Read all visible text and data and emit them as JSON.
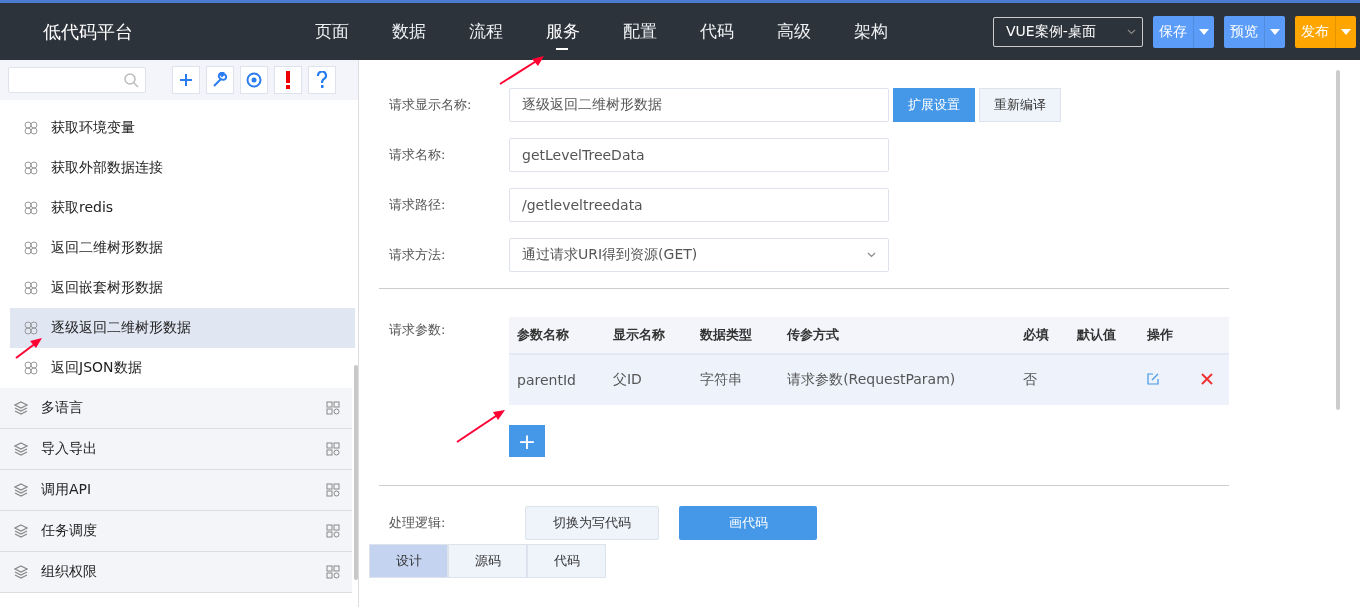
{
  "header": {
    "title": "低代码平台",
    "nav": [
      {
        "label": "页面",
        "selected": false
      },
      {
        "label": "数据",
        "selected": false
      },
      {
        "label": "流程",
        "selected": false
      },
      {
        "label": "服务",
        "selected": true
      },
      {
        "label": "配置",
        "selected": false
      },
      {
        "label": "代码",
        "selected": false
      },
      {
        "label": "高级",
        "selected": false
      },
      {
        "label": "架构",
        "selected": false
      }
    ],
    "project_select": "VUE案例-桌面",
    "buttons": [
      {
        "label": "保存",
        "kind": "blue"
      },
      {
        "label": "预览",
        "kind": "blue"
      },
      {
        "label": "发布",
        "kind": "orange"
      }
    ]
  },
  "sidebar": {
    "tools": [
      {
        "kind": "plus"
      },
      {
        "kind": "wrench"
      },
      {
        "kind": "target"
      },
      {
        "kind": "alert"
      },
      {
        "kind": "help"
      }
    ],
    "items": [
      {
        "label": "获取环境变量",
        "selected": false
      },
      {
        "label": "获取外部数据连接",
        "selected": false
      },
      {
        "label": "获取redis",
        "selected": false
      },
      {
        "label": "返回二维树形数据",
        "selected": false
      },
      {
        "label": "返回嵌套树形数据",
        "selected": false
      },
      {
        "label": "逐级返回二维树形数据",
        "selected": true
      },
      {
        "label": "返回JSON数据",
        "selected": false
      }
    ],
    "groups": [
      "多语言",
      "导入导出",
      "调用API",
      "任务调度",
      "组织权限"
    ]
  },
  "form": {
    "display_name": {
      "label": "请求显示名称:",
      "value": "逐级返回二维树形数据"
    },
    "extend_button": "扩展设置",
    "recompile_button": "重新编译",
    "name": {
      "label": "请求名称:",
      "value": "getLevelTreeData"
    },
    "path": {
      "label": "请求路径:",
      "value": "/getleveltreedata"
    },
    "method": {
      "label": "请求方法:",
      "value": "通过请求URI得到资源(GET)"
    }
  },
  "params": {
    "label": "请求参数:",
    "columns": [
      "参数名称",
      "显示名称",
      "数据类型",
      "传参方式",
      "必填",
      "默认值",
      "操作"
    ],
    "rows": [
      [
        "parentId",
        "父ID",
        "字符串",
        "请求参数(RequestParam)",
        "否",
        ""
      ]
    ],
    "add_button": "+"
  },
  "logic": {
    "label": "处理逻辑:",
    "switch_button": "切换为写代码",
    "draw_button": "画代码"
  },
  "bottom_tabs": [
    {
      "label": "设计",
      "selected": true
    },
    {
      "label": "源码",
      "selected": false
    },
    {
      "label": "代码",
      "selected": false
    }
  ]
}
